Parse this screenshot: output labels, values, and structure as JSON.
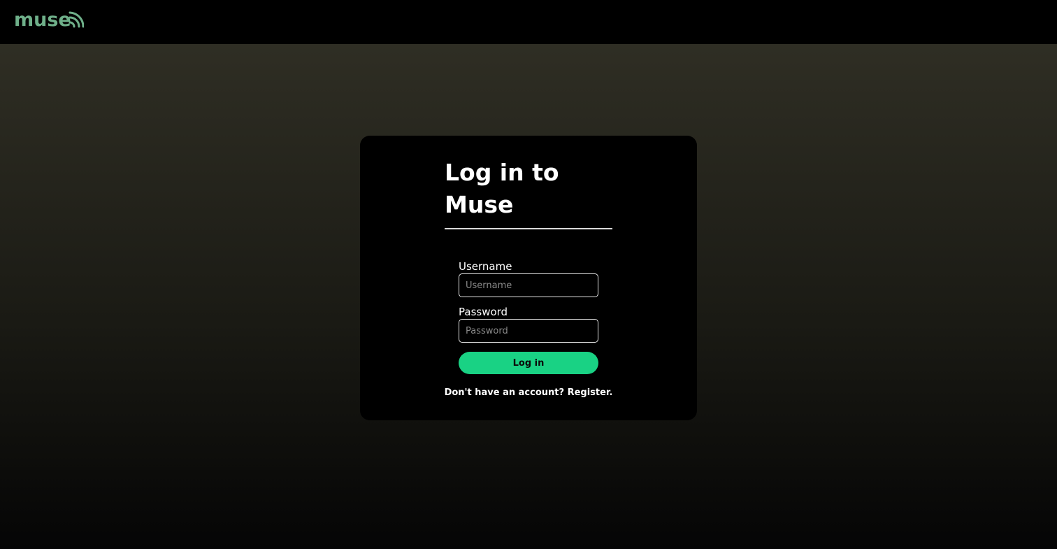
{
  "header": {
    "logo_text": "muse",
    "logo_color": "#6fb08a"
  },
  "login_card": {
    "title": "Log in to Muse",
    "username": {
      "label": "Username",
      "placeholder": "Username",
      "value": ""
    },
    "password": {
      "label": "Password",
      "placeholder": "Password",
      "value": ""
    },
    "login_button_label": "Log in",
    "register_prompt": "Don't have an account?",
    "register_link": "Register."
  },
  "colors": {
    "accent": "#19d284",
    "card_background": "#000000",
    "page_background_top": "#2f2e24",
    "page_background_bottom": "#050505"
  },
  "icons": {
    "logo_waves": "signal-waves-icon"
  }
}
